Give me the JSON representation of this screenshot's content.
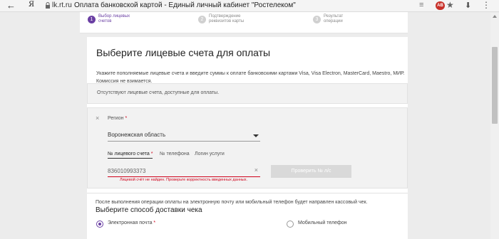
{
  "browser": {
    "back_icon": "←",
    "yandex_logo": "Я",
    "domain": "lk.rt.ru",
    "page_title": "Оплата банковской картой - Единый личный кабинет \"Ростелеком\"",
    "menu_icon": "≡",
    "extension_badge": "AB",
    "star_icon": "★",
    "download_icon": "⬇",
    "more_icon": "⋮"
  },
  "steps": [
    {
      "num": "1",
      "label": "Выбор лицевых счетов"
    },
    {
      "num": "2",
      "label": "Подтверждение реквизитов карты"
    },
    {
      "num": "3",
      "label": "Результат операции"
    }
  ],
  "page": {
    "title": "Выберите лицевые счета для оплаты",
    "description": "Укажите пополняемые лицевые счета и введите суммы к оплате банковскими картами Visa, Visa Electron, MasterCard, Maestro, МИР. Комиссия не взимается.",
    "no_accounts_notice": "Отсутствуют лицевые счета, доступные для оплаты."
  },
  "account_form": {
    "close_icon": "×",
    "region_label": "Регион",
    "required_mark": "*",
    "region_value": "Воронежская область",
    "tabs": [
      {
        "label": "№ лицевого счета"
      },
      {
        "label": "№ телефона"
      },
      {
        "label": "Логин услуги"
      }
    ],
    "account_value": "836010993373",
    "clear_icon": "×",
    "error_text": "Лицевой счёт не найден. Проверьте корректность введенных данных.",
    "check_button": "Проверить № л/с"
  },
  "delivery": {
    "note": "После выполнения операции оплаты на электронную почту или мобильный телефон будет направлен кассовый чек.",
    "heading": "Выберите способ доставки чека",
    "options": [
      {
        "label": "Электронная почта",
        "selected": true
      },
      {
        "label": "Мобильный телефон",
        "selected": false
      }
    ]
  },
  "colors": {
    "accent": "#6a3fa3",
    "error": "#d0021b"
  }
}
